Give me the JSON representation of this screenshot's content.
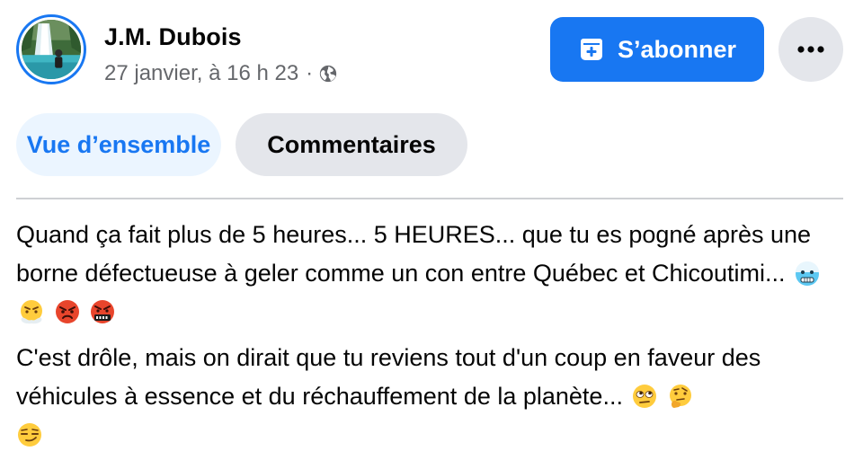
{
  "author": {
    "name": "J.M. Dubois",
    "timestamp": "27 janvier, à 16 h 23",
    "separator": "·",
    "visibility_icon": "globe-icon"
  },
  "actions": {
    "subscribe_label": "S’abonner",
    "subscribe_icon": "subscribe-icon",
    "more_icon": "more-dots-icon"
  },
  "tabs": [
    {
      "label": "Vue d’ensemble",
      "selected": true
    },
    {
      "label": "Commentaires",
      "selected": false
    }
  ],
  "post": {
    "paragraph1": "Quand ça fait plus de 5 heures... 5 HEURES... que tu es pogné après une borne défectueuse à geler comme un con entre Québec et Chicoutimi...",
    "paragraph1_emojis": [
      "cold-face-emoji",
      "steam-nose-face-emoji",
      "angry-face-emoji",
      "cursing-face-emoji"
    ],
    "paragraph2": "C'est drôle, mais on dirait que tu reviens tout d'un coup en faveur des véhicules à essence et du réchauffement de la planète...",
    "paragraph2_emojis": [
      "rolling-eyes-emoji",
      "thinking-face-emoji",
      "smirking-face-emoji"
    ]
  },
  "colors": {
    "accent": "#1877f2",
    "accent_light": "#ebf5ff",
    "button_gray": "#e4e6eb",
    "text_primary": "#050505",
    "text_secondary": "#65676b",
    "divider": "#ced0d4"
  }
}
